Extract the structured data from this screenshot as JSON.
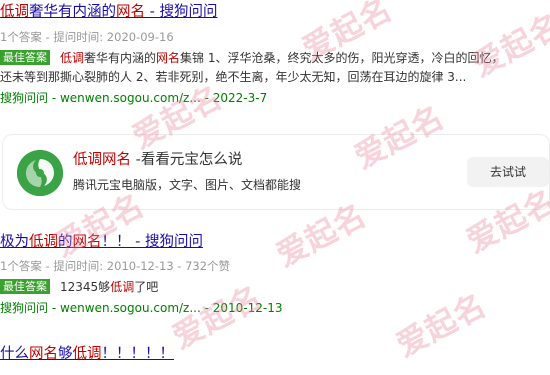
{
  "results": [
    {
      "title_parts": [
        {
          "text": "低调",
          "hl": true
        },
        {
          "text": "奢华有内涵的",
          "hl": false
        },
        {
          "text": "网名",
          "hl": true
        },
        {
          "text": " - 搜狗问问",
          "hl": false
        }
      ],
      "meta": "1个答案 - 提问时间: 2020-09-16",
      "badge": "最佳答案",
      "snippet_line1_parts": [
        {
          "text": "低调",
          "hl": true
        },
        {
          "text": "奢华有内涵的",
          "hl": false
        },
        {
          "text": "网名",
          "hl": true
        },
        {
          "text": "集锦 1、浮华沧桑，终究太多的伤，阳光穿透，冷白的回忆，",
          "hl": false
        }
      ],
      "snippet_line2": "还未等到那撕心裂肺的人 2、若非死别，绝不生离，年少太无知，回荡在耳边的旋律 3...",
      "source_site": "搜狗问问",
      "source_url": "wenwen.sogou.com/z...",
      "source_date": "2022-3-7"
    },
    {
      "title_parts": [
        {
          "text": "极为",
          "hl": false
        },
        {
          "text": "低调",
          "hl": true
        },
        {
          "text": "的",
          "hl": false
        },
        {
          "text": "网名",
          "hl": true
        },
        {
          "text": "！！ - 搜狗问问",
          "hl": false
        }
      ],
      "meta": "1个答案 - 提问时间: 2010-12-13 - 732个赞",
      "badge": "最佳答案",
      "snippet_parts": [
        {
          "text": "12345够",
          "hl": false
        },
        {
          "text": "低调",
          "hl": true
        },
        {
          "text": "了吧",
          "hl": false
        }
      ],
      "source_site": "搜狗问问",
      "source_url": "wenwen.sogou.com/z...",
      "source_date": "2010-12-13"
    },
    {
      "title_parts": [
        {
          "text": "什么",
          "hl": false
        },
        {
          "text": "网名",
          "hl": true
        },
        {
          "text": "够",
          "hl": false
        },
        {
          "text": "低调",
          "hl": true
        },
        {
          "text": "！！！！！",
          "hl": false
        }
      ]
    }
  ],
  "card": {
    "title_hl": "低调网名",
    "title_rest": " -看看元宝怎么说",
    "desc": "腾讯元宝电脑版，文字、图片、文档都能搜",
    "button": "去试试",
    "logo_icon": "yuanbao-logo-icon",
    "logo_color": "#3aa345"
  },
  "watermark_text": "爱起名",
  "colors": {
    "link": "#1a0dab",
    "highlight": "#c00000",
    "source": "#008000",
    "badge": "#3aa02e",
    "watermark": "#e98ca0"
  }
}
